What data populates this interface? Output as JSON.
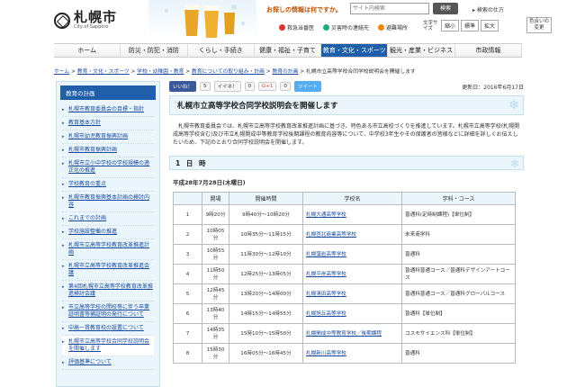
{
  "header": {
    "logo_main": "札幌市",
    "logo_sub": "City of Sapporo",
    "search_label": "お探しの情報は何ですか。",
    "search_placeholder": "サイト内検索",
    "search_button": "検索",
    "search_help": "▸ 検索の仕方",
    "emergency_links": [
      "救急当番医",
      "災害時の連絡先",
      "避難場所"
    ],
    "font_size_label": "文字サイズ",
    "font_size_buttons": [
      "縮小",
      "標準",
      "拡大"
    ],
    "color_change": "色合いの変更"
  },
  "nav": [
    "ホーム",
    "防災・防犯・消防",
    "くらし・手続き",
    "健康・福祉・子育て",
    "教育・文化・スポーツ",
    "観光・産業・ビジネス",
    "市政情報"
  ],
  "breadcrumb": [
    "ホーム",
    "教育・文化・スポーツ",
    "学校・幼稚園・教育",
    "教育についての取り組み・計画",
    "教育の計画",
    "札幌市立高等学校合同学校説明会を開催します"
  ],
  "sidebar": {
    "heading": "教育の計画",
    "items": [
      "札幌市教育委員会の目標・指針",
      "教育基本方針",
      "札幌市幼児教育振興計画",
      "札幌市教育振興計画",
      "札幌市立小中学校の学校規模の適正化の推進",
      "学校教育の重点",
      "札幌市教育振興基本計画の検討内容",
      "これまでの計画",
      "学校施設整備の推進",
      "札幌市立高等学校教育改革推進計画",
      "札幌市立高等学校教育改革推進会議",
      "第4回札幌市立高等学校教育改革推進検討会議",
      "市立高等学校の閉校等に伴う卒業証明書等補証明の発行について",
      "中高一貫教育校の設置について",
      "札幌市立高等学校合同学校説明会を開催します",
      "評価基準について"
    ]
  },
  "share": {
    "like": "いいね！",
    "like_count": "5",
    "iine": "イイネ！",
    "iine_count": "0",
    "gplus": "G+1",
    "gplus_count": "0",
    "tweet": "ツイート",
    "updated": "更新日：2016年6月17日"
  },
  "main": {
    "title": "札幌市立高等学校合同学校説明会を開催します",
    "intro": "札幌市教育委員会では、札幌市立高等学校教育改革推進計画に基づき、特色ある市立高校づくりを推進しています。札幌市立高等学校(札幌開成高等学校含む)及び市立札幌開成中等教育学校後期課程の教育内容等について、中学校3年生やその保護者の皆様などに詳細を詳しくお伝えしたいため、下記のとおり合同学校説明会を開催します。",
    "section_title": "1 日 時",
    "date": "平成28年7月28日(木曜日)",
    "table_headers": [
      "開場",
      "",
      "開催時間",
      "学校名",
      "学科・コース"
    ],
    "rows": [
      {
        "no": "1",
        "open": "9時20分",
        "time": "9時40分〜10時20分",
        "school": "札幌大通高等学校",
        "course": "普通科(定時制課程)【単位制】"
      },
      {
        "no": "2",
        "open": "10時05分",
        "time": "10時35分〜11時15分",
        "school": "札幌啓北商業高等学校",
        "course": "未来商学科"
      },
      {
        "no": "3",
        "open": "10時55分",
        "time": "11時30分〜12時10分",
        "school": "札幌藻岩高等学校",
        "course": "普通科"
      },
      {
        "no": "4",
        "open": "11時50分",
        "time": "12時25分〜13時05分",
        "school": "札幌平岸高等学校",
        "course": "普通科普通コース／普通科デザインアートコース"
      },
      {
        "no": "5",
        "open": "12時45分",
        "time": "13時20分〜14時00分",
        "school": "札幌清田高等学校",
        "course": "普通科普通コース／普通科グローバルコース"
      },
      {
        "no": "6",
        "open": "13時40分",
        "time": "14時15分〜14時55分",
        "school": "札幌旭丘高等学校",
        "course": "普通科【単位制】"
      },
      {
        "no": "7",
        "open": "14時35分",
        "time": "15時10分〜15時50分",
        "school": "札幌開成中等教育学校／後期課程",
        "course": "コスモサイエンス科【単位制】"
      },
      {
        "no": "8",
        "open": "15時30分",
        "time": "16時05分〜16時45分",
        "school": "札幌新川高等学校",
        "course": "普通科"
      }
    ]
  }
}
